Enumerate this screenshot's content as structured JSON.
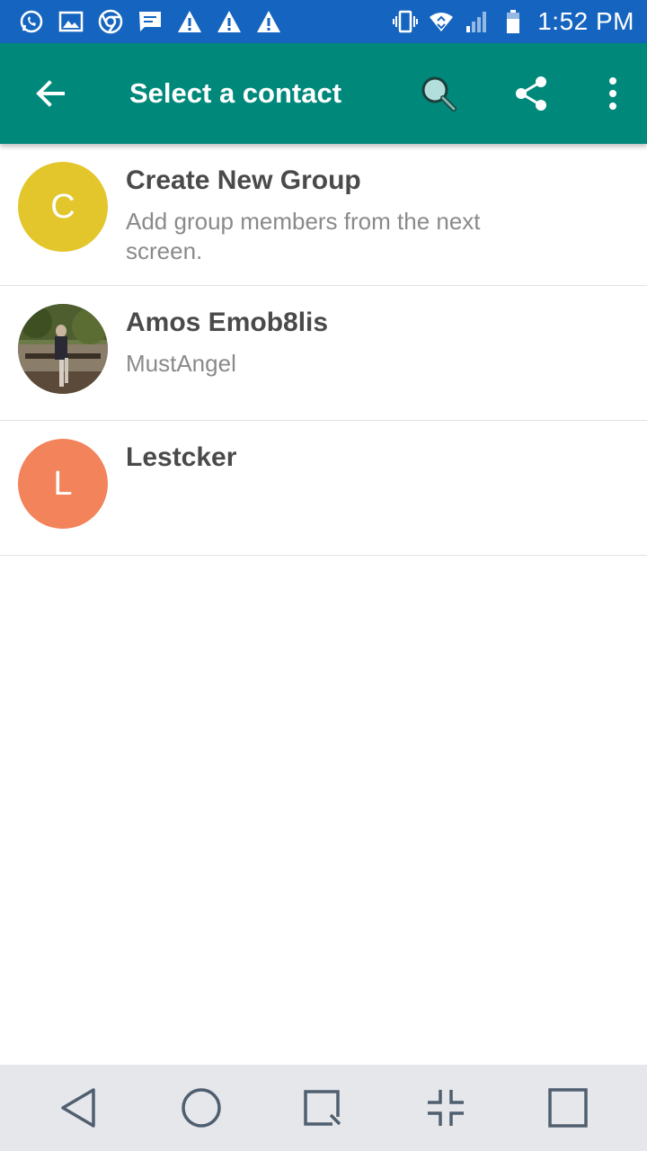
{
  "status_bar": {
    "time": "1:52 PM",
    "left_icons": [
      "whatsapp-icon",
      "gallery-icon",
      "chrome-icon",
      "message-icon",
      "warning-icon",
      "warning-icon",
      "warning-icon"
    ],
    "right_icons": [
      "vibrate-icon",
      "wifi-icon",
      "signal-icon",
      "battery-icon"
    ],
    "background": "#1565c0"
  },
  "toolbar": {
    "title": "Select a contact",
    "background": "#00897b",
    "icons": [
      "back-arrow-icon",
      "search-icon",
      "share-icon",
      "more-vert-icon"
    ]
  },
  "contacts": [
    {
      "name": "Create New Group",
      "subtitle": "Add group members from the next screen.",
      "avatar_letter": "C",
      "avatar_color": "#e3c62c"
    },
    {
      "name": "Amos Emob8lis",
      "subtitle": "MustAngel",
      "avatar_letter": "",
      "avatar_color": "#5a6b3a"
    },
    {
      "name": "Lestcker",
      "subtitle": "",
      "avatar_letter": "L",
      "avatar_color": "#f2835a"
    }
  ],
  "nav_bar": {
    "icons": [
      "back-triangle-icon",
      "home-circle-icon",
      "recents-icon",
      "collapse-icon",
      "square-icon"
    ],
    "background": "#e6e7eb"
  }
}
